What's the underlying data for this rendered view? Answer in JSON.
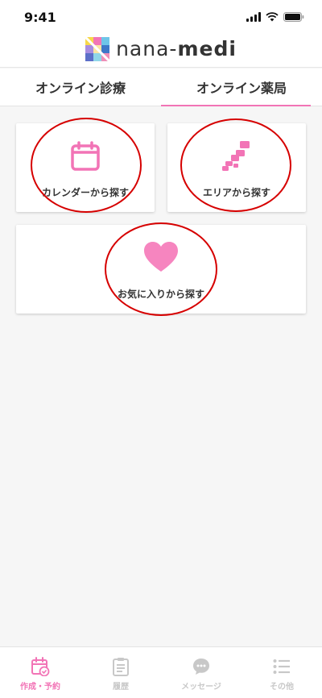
{
  "status_bar": {
    "time": "9:41"
  },
  "header": {
    "logo_light": "nana-",
    "logo_bold": "medi"
  },
  "tabs": [
    {
      "label": "オンライン診療",
      "active": false
    },
    {
      "label": "オンライン薬局",
      "active": true
    }
  ],
  "cards": {
    "calendar": {
      "label": "カレンダーから探す",
      "icon": "calendar-icon"
    },
    "area": {
      "label": "エリアから探す",
      "icon": "japan-map-icon"
    },
    "favorite": {
      "label": "お気に入りから探す",
      "icon": "heart-icon"
    }
  },
  "bottom_nav": [
    {
      "label": "作成・予約",
      "icon": "calendar-check-icon",
      "active": true
    },
    {
      "label": "履歴",
      "icon": "clipboard-icon",
      "active": false
    },
    {
      "label": "メッセージ",
      "icon": "chat-bubble-icon",
      "active": false
    },
    {
      "label": "その他",
      "icon": "list-icon",
      "active": false
    }
  ],
  "colors": {
    "accent": "#f274b6",
    "annotation": "#d60000",
    "inactive": "#c8c8c8"
  }
}
